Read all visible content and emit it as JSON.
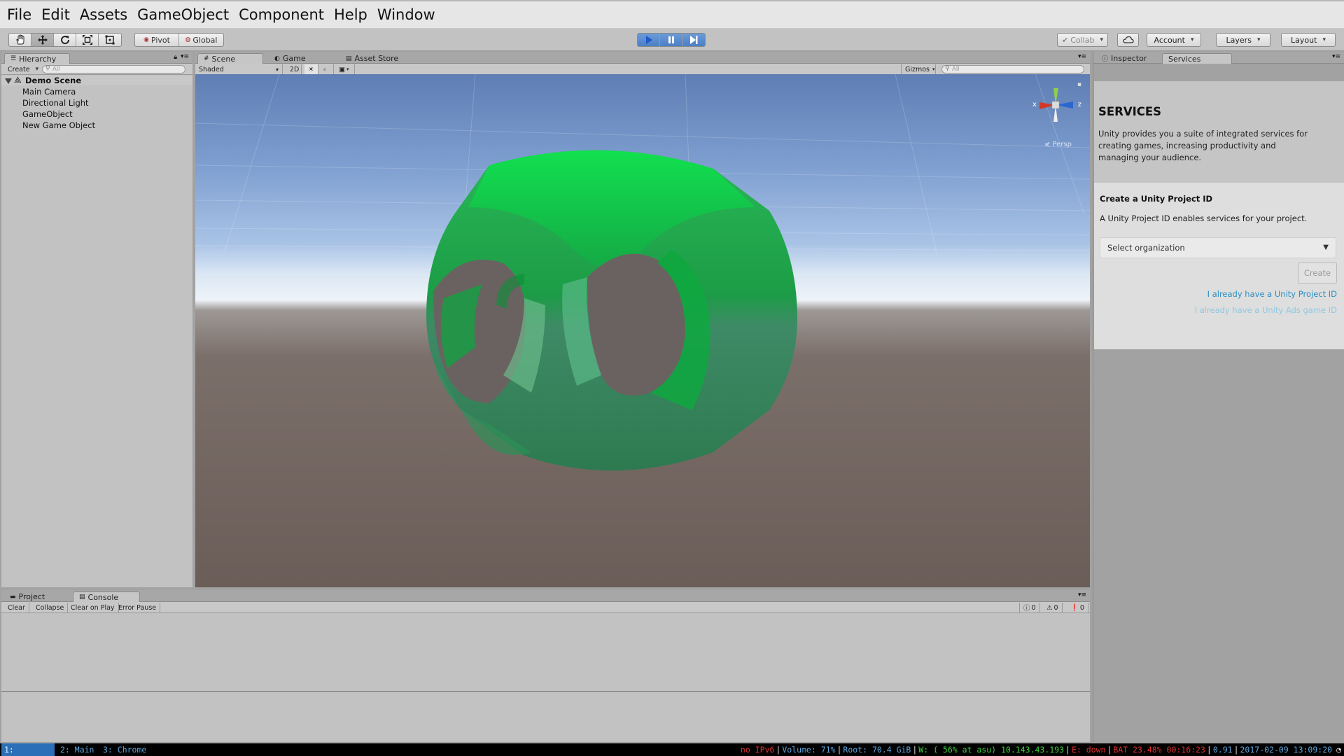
{
  "menu": [
    "File",
    "Edit",
    "Assets",
    "GameObject",
    "Component",
    "Help",
    "Window"
  ],
  "toolbar": {
    "pivot": "Pivot",
    "global": "Global",
    "collab": "Collab",
    "account": "Account",
    "layers": "Layers",
    "layout": "Layout"
  },
  "hierarchy": {
    "tab": "Hierarchy",
    "create": "Create",
    "search_placeholder": "All",
    "scene": "Demo Scene",
    "items": [
      "Main Camera",
      "Directional Light",
      "GameObject",
      "New Game Object"
    ]
  },
  "scene": {
    "tabs": [
      "Scene",
      "Game",
      "Asset Store"
    ],
    "shading": "Shaded",
    "mode2d": "2D",
    "gizmos": "Gizmos",
    "search_placeholder": "All",
    "persp": "Persp",
    "axis_x": "x",
    "axis_z": "z",
    "colors": {
      "object": "#1fa64a",
      "sky_top": "#5f7eb4",
      "ground": "#6b5d58"
    }
  },
  "console": {
    "tabs": [
      "Project",
      "Console"
    ],
    "buttons": [
      "Clear",
      "Collapse",
      "Clear on Play",
      "Error Pause"
    ],
    "counts": [
      "0",
      "0",
      "0"
    ]
  },
  "inspector": {
    "tabs": [
      "Inspector",
      "Services"
    ],
    "heading": "SERVICES",
    "description": "Unity provides you a suite of integrated services for creating games, increasing productivity and managing your audience.",
    "create_title": "Create a Unity Project ID",
    "create_desc": "A Unity Project ID enables services for your project.",
    "select_org": "Select organization",
    "create_button": "Create",
    "link_project_id": "I already have a Unity Project ID",
    "link_ads_id": "I already have a Unity Ads game ID",
    "link_color": "#2a8fc4"
  },
  "statusbar": {
    "workspaces": [
      "1: Clients",
      "2: Main",
      "3: Chrome"
    ],
    "ipv6": "no IPv6",
    "volume": "Volume: 71%",
    "root": "Root: 70.4 GiB",
    "wifi": "W: ( 56% at asu) 10.143.43.193",
    "eth": "E: down",
    "battery": "BAT 23.48% 00:16:23",
    "load": "0.91",
    "datetime": "2017-02-09 13:09:20"
  }
}
